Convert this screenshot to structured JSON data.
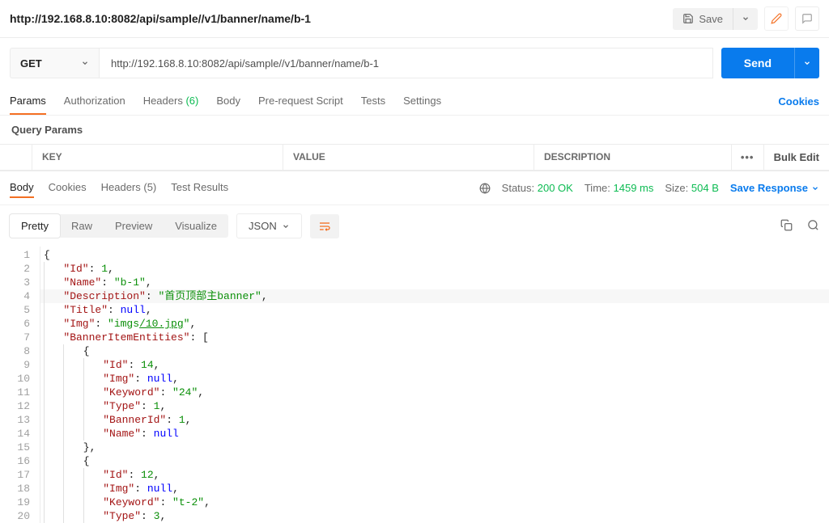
{
  "topbar": {
    "url_display": "http://192.168.8.10:8082/api/sample//v1/banner/name/b-1",
    "save_label": "Save"
  },
  "request": {
    "method": "GET",
    "url": "http://192.168.8.10:8082/api/sample//v1/banner/name/b-1",
    "send_label": "Send"
  },
  "tabs": {
    "params": "Params",
    "authorization": "Authorization",
    "headers": "Headers",
    "headers_count": "(6)",
    "body": "Body",
    "prerequest": "Pre-request Script",
    "tests": "Tests",
    "settings": "Settings",
    "cookies": "Cookies"
  },
  "query_params_label": "Query Params",
  "params_header": {
    "key": "KEY",
    "value": "VALUE",
    "description": "DESCRIPTION",
    "bulk_edit": "Bulk Edit"
  },
  "resp_tabs": {
    "body": "Body",
    "cookies": "Cookies",
    "headers": "Headers",
    "headers_count": "(5)",
    "test_results": "Test Results"
  },
  "resp_status": {
    "status_label": "Status:",
    "status_value": "200 OK",
    "time_label": "Time:",
    "time_value": "1459 ms",
    "size_label": "Size:",
    "size_value": "504 B",
    "save_response": "Save Response"
  },
  "view_tabs": {
    "pretty": "Pretty",
    "raw": "Raw",
    "preview": "Preview",
    "visualize": "Visualize"
  },
  "format": "JSON",
  "json_body": {
    "Id": 1,
    "Name": "b-1",
    "Description": "首页顶部主banner",
    "Title": null,
    "Img": "imgs/10.jpg",
    "BannerItemEntities": [
      {
        "Id": 14,
        "Img": null,
        "Keyword": "24",
        "Type": 1,
        "BannerId": 1,
        "Name": null
      },
      {
        "Id": 12,
        "Img": null,
        "Keyword": "t-2",
        "Type": 3
      }
    ]
  },
  "code_lines": [
    "{",
    "    \"Id\": 1,",
    "    \"Name\": \"b-1\",",
    "    \"Description\": \"首页顶部主banner\",",
    "    \"Title\": null,",
    "    \"Img\": \"imgs/10.jpg\",",
    "    \"BannerItemEntities\": [",
    "        {",
    "            \"Id\": 14,",
    "            \"Img\": null,",
    "            \"Keyword\": \"24\",",
    "            \"Type\": 1,",
    "            \"BannerId\": 1,",
    "            \"Name\": null",
    "        },",
    "        {",
    "            \"Id\": 12,",
    "            \"Img\": null,",
    "            \"Keyword\": \"t-2\",",
    "            \"Type\": 3,"
  ]
}
